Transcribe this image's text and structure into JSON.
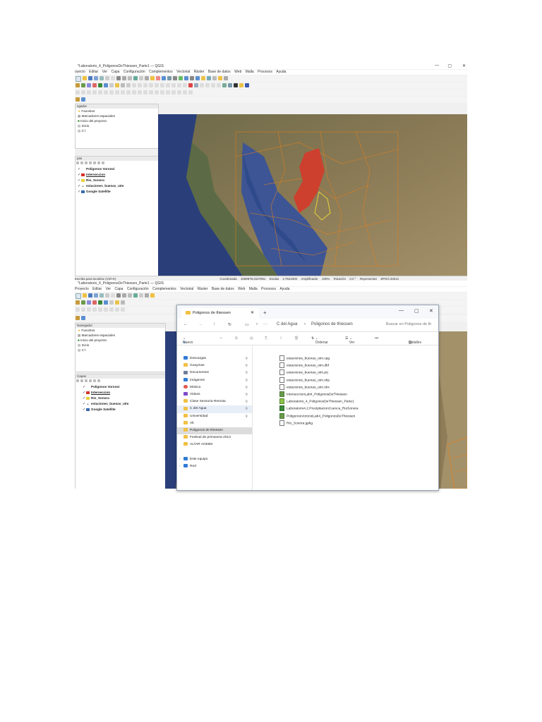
{
  "top_window": {
    "title": "*Laboratorio_4_PoligonosDeThiessen_Parte1 — QGIS",
    "controls": [
      "—",
      "▢",
      "✕"
    ],
    "menu": [
      "oyecto",
      "Editar",
      "Ver",
      "Capa",
      "Configuración",
      "Complementos",
      "Vectorial",
      "Ráster",
      "Base de datos",
      "Web",
      "Malla",
      "Procesos",
      "Ayuda"
    ],
    "browser_header": "egador",
    "browser_items": [
      "Favoritos",
      "Marcadores espaciales",
      "Inicio del proyecto",
      "Inicio",
      "C:\\"
    ],
    "layers_header": "pas",
    "layers": [
      {
        "name": "Poligonos Voronoi",
        "color": ""
      },
      {
        "name": "Interseccion",
        "color": "#d9342b"
      },
      {
        "name": "Rio_Sonora",
        "color": "#e8d23a"
      },
      {
        "name": "estaciones_buenas_utm",
        "color": ""
      },
      {
        "name": "Google Satellite",
        "color": ""
      }
    ],
    "status": {
      "search_placeholder": "Escriba para localizar (Ctrl+K)",
      "coordinate_label": "Coordenada",
      "coordinate_value": "1059978,3107961",
      "scale_label": "Escala",
      "scale_value": "1:7523402",
      "magnifier_label": "Amplificador",
      "magnifier_value": "100%",
      "rotation_label": "Rotación",
      "rotation_value": "0,0 °",
      "render_label": "Representar",
      "crs": "EPSG:32612"
    }
  },
  "bottom_window": {
    "title": "*Laboratorio_4_PoligonosDeThiessen_Parte1 — QGIS",
    "menu": [
      "Proyecto",
      "Editar",
      "Ver",
      "Capa",
      "Configuración",
      "Complementos",
      "Vectorial",
      "Ráster",
      "Base de datos",
      "Web",
      "Malla",
      "Procesos",
      "Ayuda"
    ],
    "browser_header": "Navegador",
    "browser_items": [
      "Favoritos",
      "Marcadores espaciales",
      "Inicio del proyecto",
      "Inicio",
      "C:\\"
    ],
    "layers_header": "Capas",
    "layers": [
      {
        "name": "Poligonos Voronoi",
        "color": ""
      },
      {
        "name": "Interseccion",
        "color": "#d9342b"
      },
      {
        "name": "Rio_Sonora",
        "color": "#e8d23a"
      },
      {
        "name": "estaciones_buenas_utm",
        "color": ""
      },
      {
        "name": "Google Satellite",
        "color": ""
      }
    ]
  },
  "explorer": {
    "tab_title": "Poligonos de thiessen",
    "new_tab": "+",
    "controls": [
      "—",
      "▢",
      "✕"
    ],
    "breadcrumb": [
      "C del Agua",
      "Poligonos de thiessen"
    ],
    "search_placeholder": "Buscar en Poligonos de th",
    "commands": {
      "new": "Nuevo",
      "sort": "Ordenar",
      "view": "Ver",
      "more": "•••",
      "details": "Detalles"
    },
    "sidebar": [
      {
        "label": "Descargas",
        "color": "#2f7bd6",
        "pinned": true
      },
      {
        "label": "Guaymas",
        "color": "#f2c042",
        "pinned": true
      },
      {
        "label": "Documentos",
        "color": "#6b7f99",
        "pinned": true
      },
      {
        "label": "Imágenes",
        "color": "#2f7bd6",
        "pinned": true
      },
      {
        "label": "Música",
        "color": "#e2574c",
        "pinned": true
      },
      {
        "label": "Videos",
        "color": "#7d4cc9",
        "pinned": true
      },
      {
        "label": "Clase Sensoria Remota",
        "color": "#f2c042",
        "pinned": true
      },
      {
        "label": "C del Agua",
        "color": "#f2c042",
        "pinned": true
      },
      {
        "label": "Universidad",
        "color": "#f2c042",
        "pinned": true
      },
      {
        "label": "Alt",
        "color": "#f2c042",
        "pinned": false
      },
      {
        "label": "Poligonos de thiessen",
        "color": "#f2c042",
        "pinned": false
      },
      {
        "label": "Festival de primavera 2013",
        "color": "#f2c042",
        "pinned": false
      },
      {
        "label": "ALTAR AGEBS",
        "color": "#f2c042",
        "pinned": false
      },
      {
        "label": "",
        "color": "",
        "pinned": false
      },
      {
        "label": "Este equipo",
        "color": "#2f7bd6",
        "pinned": false
      },
      {
        "label": "Red",
        "color": "#2f7bd6",
        "pinned": false
      }
    ],
    "files": [
      "estaciones_buenas_utm.cpg",
      "estaciones_buenas_utm.dbf",
      "estaciones_buenas_utm.prj",
      "estaciones_buenas_utm.shp",
      "estaciones_buenas_utm.shx",
      "InterseccionLab4_PoligonosDeThiessen",
      "Laboratorio_4_PoligonosDeThiessen_Parte1",
      "Laboratorio4.2.PrecipitacionCuenca_RioSonora",
      "PoligonosVoronoiLab4_PoligonosDeThiessen",
      "Rio_Sonora.gpkg"
    ]
  }
}
